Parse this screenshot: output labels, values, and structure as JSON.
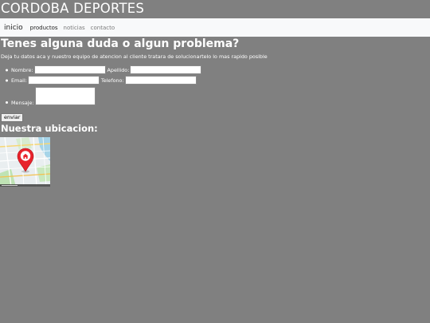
{
  "header": {
    "site_title": "CORDOBA DEPORTES"
  },
  "navbar": {
    "brand": "inicio",
    "links": [
      {
        "label": "productos",
        "active": true
      },
      {
        "label": "noticias",
        "active": false
      },
      {
        "label": "contacto",
        "active": false
      }
    ]
  },
  "main": {
    "heading": "Tenes alguna duda o algun problema?",
    "intro": "Deja tu datos aca y nuestro equipo de atencion al cliente tratara de solucionartelo lo mas rapido posible",
    "form": {
      "nombre_label": "Nombre:",
      "nombre_value": "",
      "apellido_label": "Apellido:",
      "apellido_value": "",
      "email_label": "Email:",
      "email_value": "",
      "telefono_label": "Telefono:",
      "telefono_value": "",
      "mensaje_label": "Mensaje:",
      "mensaje_value": "",
      "submit_label": "enviar"
    },
    "location_heading": "Nuestra ubicacion:",
    "map": {
      "icon": "map-pin-home-icon",
      "pin_color": "#e8232c"
    }
  }
}
